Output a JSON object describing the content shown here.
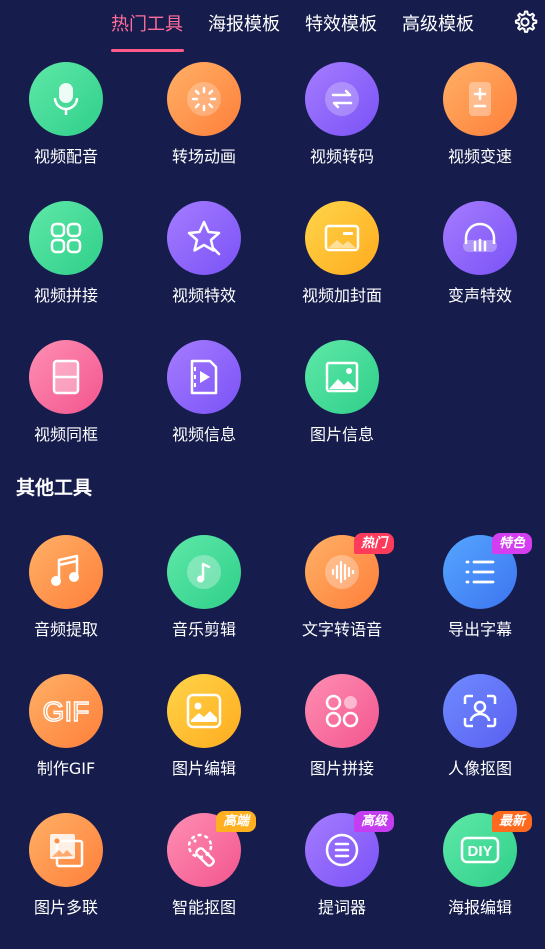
{
  "tabs": [
    {
      "label": "热门工具",
      "active": true
    },
    {
      "label": "海报模板",
      "active": false
    },
    {
      "label": "特效模板",
      "active": false
    },
    {
      "label": "高级模板",
      "active": false
    }
  ],
  "settings_icon": "gear-icon",
  "hot_tools": [
    {
      "label": "视频配音",
      "icon": "microphone-icon",
      "color": "green"
    },
    {
      "label": "转场动画",
      "icon": "loading-spinner-icon",
      "color": "orange"
    },
    {
      "label": "视频转码",
      "icon": "swap-arrows-icon",
      "color": "purple"
    },
    {
      "label": "视频变速",
      "icon": "speed-calculator-icon",
      "color": "orange"
    },
    {
      "label": "视频拼接",
      "icon": "grid-blocks-icon",
      "color": "green"
    },
    {
      "label": "视频特效",
      "icon": "star-icon",
      "color": "purple"
    },
    {
      "label": "视频加封面",
      "icon": "cover-image-icon",
      "color": "yellow"
    },
    {
      "label": "变声特效",
      "icon": "headphones-icon",
      "color": "purple"
    },
    {
      "label": "视频同框",
      "icon": "split-frame-icon",
      "color": "pink"
    },
    {
      "label": "视频信息",
      "icon": "video-file-icon",
      "color": "purple"
    },
    {
      "label": "图片信息",
      "icon": "picture-icon",
      "color": "green"
    }
  ],
  "other_section_title": "其他工具",
  "other_tools": [
    {
      "label": "音频提取",
      "icon": "music-note-icon",
      "color": "orange",
      "badge": ""
    },
    {
      "label": "音乐剪辑",
      "icon": "music-disc-icon",
      "color": "green",
      "badge": ""
    },
    {
      "label": "文字转语音",
      "icon": "sound-wave-icon",
      "color": "orange",
      "badge": "热门"
    },
    {
      "label": "导出字幕",
      "icon": "list-icon",
      "color": "blue",
      "badge": "特色"
    },
    {
      "label": "制作GIF",
      "icon": "gif-icon",
      "color": "orange",
      "badge": "",
      "icon_text": "GIF"
    },
    {
      "label": "图片编辑",
      "icon": "image-edit-icon",
      "color": "yellow",
      "badge": ""
    },
    {
      "label": "图片拼接",
      "icon": "image-collage-icon",
      "color": "pink",
      "badge": ""
    },
    {
      "label": "人像抠图",
      "icon": "portrait-scan-icon",
      "color": "indigo",
      "badge": ""
    },
    {
      "label": "图片多联",
      "icon": "stacked-photos-icon",
      "color": "orange",
      "badge": ""
    },
    {
      "label": "智能抠图",
      "icon": "smart-cutout-icon",
      "color": "pink",
      "badge": "高端"
    },
    {
      "label": "提词器",
      "icon": "teleprompter-icon",
      "color": "purple",
      "badge": "高级"
    },
    {
      "label": "海报编辑",
      "icon": "diy-icon",
      "color": "green",
      "badge": "最新",
      "icon_text": "DIY"
    }
  ],
  "badge_colors": {
    "热门": "#ff3b5c",
    "特色": "#d43df0",
    "高端": "#ffb020",
    "高级": "#c53df0",
    "最新": "#ff6a1f"
  },
  "colors": {
    "background": "#161d4d",
    "active_tab": "#ff6d9a"
  }
}
